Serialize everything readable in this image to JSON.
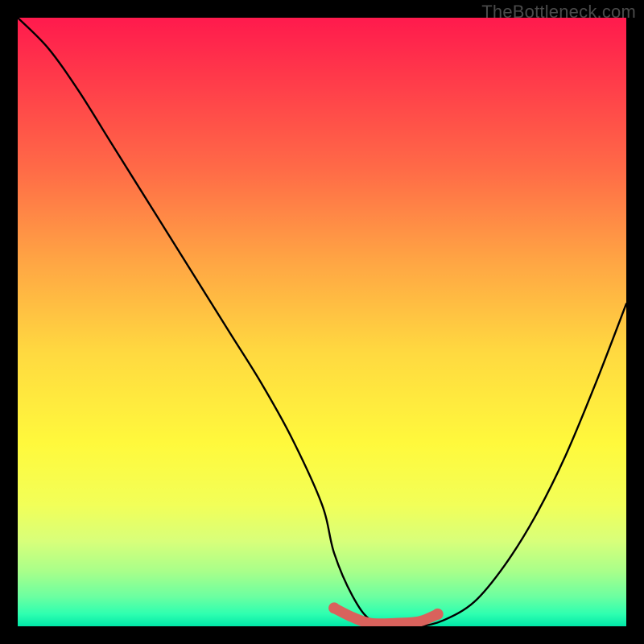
{
  "watermark": "TheBottleneck.com",
  "chart_data": {
    "type": "line",
    "title": "",
    "xlabel": "",
    "ylabel": "",
    "xlim": [
      0,
      100
    ],
    "ylim": [
      0,
      100
    ],
    "series": [
      {
        "name": "bottleneck-curve",
        "x": [
          0,
          5,
          10,
          15,
          20,
          25,
          30,
          35,
          40,
          45,
          50,
          52,
          55,
          58,
          62,
          66,
          70,
          75,
          80,
          85,
          90,
          95,
          100
        ],
        "y": [
          100,
          95,
          88,
          80,
          72,
          64,
          56,
          48,
          40,
          31,
          20,
          12,
          5,
          1,
          0,
          0,
          1,
          4,
          10,
          18,
          28,
          40,
          53
        ]
      },
      {
        "name": "optimal-zone-marker",
        "x": [
          52,
          55,
          58,
          62,
          66,
          69
        ],
        "y": [
          3,
          1.5,
          0.5,
          0.5,
          0.8,
          2
        ]
      }
    ],
    "colors": {
      "curve": "#000000",
      "marker": "#d9625c",
      "gradient_top": "#ff1a4d",
      "gradient_bottom": "#00e8a8"
    }
  }
}
